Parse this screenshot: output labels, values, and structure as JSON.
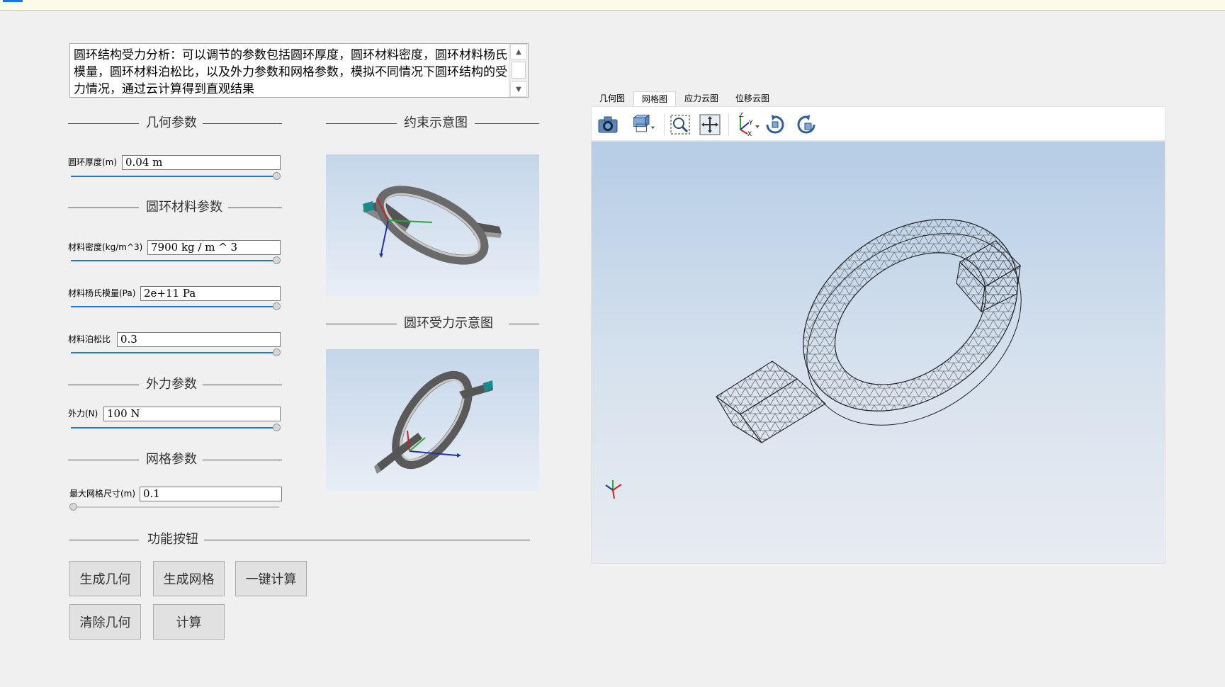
{
  "description": {
    "text": "圆环结构受力分析：可以调节的参数包括圆环厚度，圆环材料密度，圆环材料杨氏模量，圆环材料泊松比，以及外力参数和网格参数，模拟不同情况下圆环结构的受力情况，通过云计算得到直观结果"
  },
  "sections": {
    "geometry": "几何参数",
    "constraint": "约束示意图",
    "material": "圆环材料参数",
    "force_diagram": "圆环受力示意图",
    "force": "外力参数",
    "mesh": "网格参数",
    "buttons": "功能按钮"
  },
  "params": {
    "thickness": {
      "label": "圆环厚度(m)",
      "value": "0.04 m",
      "slider_fraction": 1.0
    },
    "density": {
      "label": "材料密度(kg/m^3)",
      "value": "7900 kg / m ^ 3",
      "slider_fraction": 1.0
    },
    "youngs": {
      "label": "材料杨氏模量(Pa)",
      "value": "2e+11 Pa",
      "slider_fraction": 1.0
    },
    "poisson": {
      "label": "材料泊松比",
      "value": "0.3",
      "slider_fraction": 1.0
    },
    "force": {
      "label": "外力(N)",
      "value": "100 N",
      "slider_fraction": 1.0
    },
    "mesh_size": {
      "label": "最大网格尺寸(m)",
      "value": "0.1",
      "slider_fraction": 0.0
    }
  },
  "buttons": {
    "gen_geometry": "生成几何",
    "gen_mesh": "生成网格",
    "one_click": "一键计算",
    "clear_geometry": "清除几何",
    "compute": "计算"
  },
  "tabs": [
    {
      "label": "几何图",
      "active": false
    },
    {
      "label": "网格图",
      "active": true
    },
    {
      "label": "应力云图",
      "active": false
    },
    {
      "label": "位移云图",
      "active": false
    }
  ],
  "toolbar": {
    "icons": [
      "camera-icon",
      "view-cube-icon",
      "zoom-box-icon",
      "fit-all-icon",
      "axes-icon",
      "rotate-cw-icon",
      "rotate-ccw-icon"
    ],
    "axis_labels": {
      "z": "Z",
      "y": "Y",
      "x": "X"
    }
  },
  "colors": {
    "slider_fill": "#1f77d0",
    "viewport_top": "#b6cde6",
    "viewport_bottom": "#e8ecf1"
  }
}
